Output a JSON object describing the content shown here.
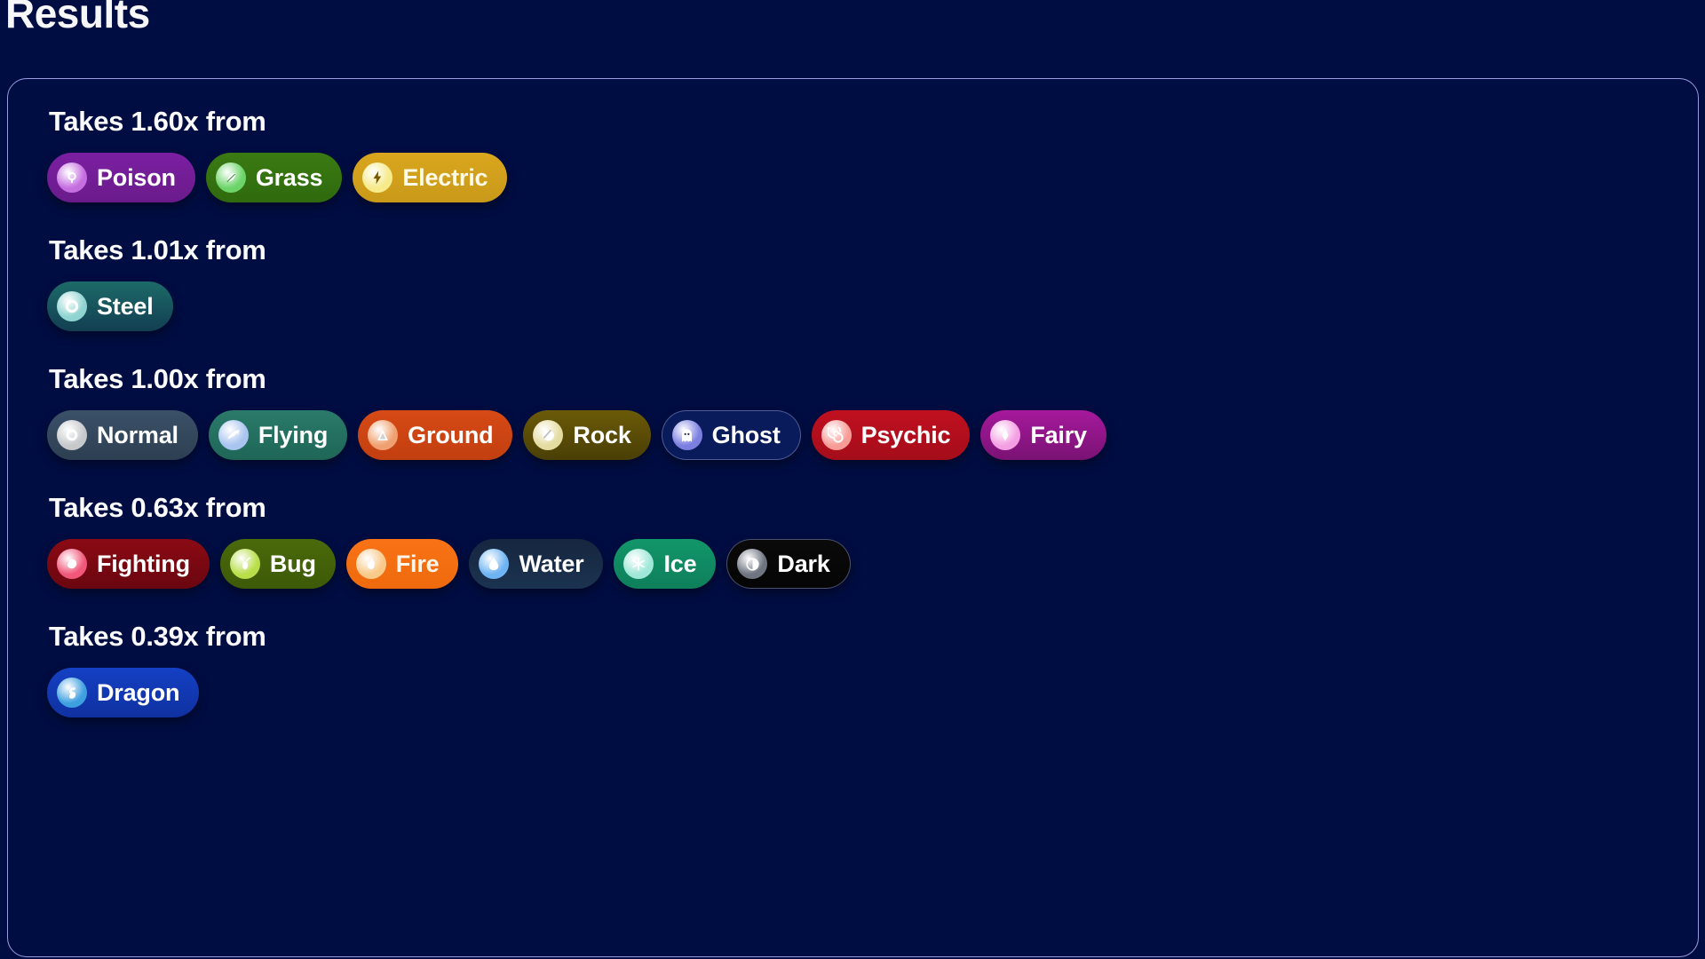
{
  "page": {
    "title": "Results",
    "background_color": "#000d42",
    "card_border_color": "#9a9ce0"
  },
  "groups": [
    {
      "heading": "Takes 1.60x from",
      "multiplier": "1.60x",
      "types": [
        {
          "label": "Poison",
          "icon": "poison-icon",
          "pill_color": "#7b1fa2",
          "pill_color2": "#6a1b8a",
          "icon_bg": "#c56ee0",
          "icon_fg": "#ffffff",
          "text_color": "#ffffff",
          "ringed": false
        },
        {
          "label": "Grass",
          "icon": "grass-icon",
          "pill_color": "#3a7a12",
          "pill_color2": "#2f6a0e",
          "icon_bg": "#6dd46a",
          "icon_fg": "#ffffff",
          "text_color": "#ffffff",
          "ringed": false
        },
        {
          "label": "Electric",
          "icon": "electric-icon",
          "pill_color": "#d9a61d",
          "pill_color2": "#c9991a",
          "icon_bg": "#f6ea8a",
          "icon_fg": "#7a5a00",
          "text_color": "#fffbe8",
          "ringed": false
        }
      ]
    },
    {
      "heading": "Takes 1.01x from",
      "multiplier": "1.01x",
      "types": [
        {
          "label": "Steel",
          "icon": "steel-icon",
          "pill_color": "#1d6a68",
          "pill_color2": "#123f52",
          "icon_bg": "#8fd4d0",
          "icon_fg": "#ffffff",
          "text_color": "#ffffff",
          "ringed": false
        }
      ]
    },
    {
      "heading": "Takes 1.00x from",
      "multiplier": "1.00x",
      "types": [
        {
          "label": "Normal",
          "icon": "normal-icon",
          "pill_color": "#3b5168",
          "pill_color2": "#2d3f52",
          "icon_bg": "#c6c8ca",
          "icon_fg": "#ffffff",
          "text_color": "#ffffff",
          "ringed": false
        },
        {
          "label": "Flying",
          "icon": "flying-icon",
          "pill_color": "#2a7a6a",
          "pill_color2": "#1f6657",
          "icon_bg": "#a8c4ef",
          "icon_fg": "#ffffff",
          "text_color": "#ffffff",
          "ringed": false
        },
        {
          "label": "Ground",
          "icon": "ground-icon",
          "pill_color": "#d64a16",
          "pill_color2": "#c23f10",
          "icon_bg": "#f0a070",
          "icon_fg": "#ffffff",
          "text_color": "#ffffff",
          "ringed": false
        },
        {
          "label": "Rock",
          "icon": "rock-icon",
          "pill_color": "#6b5a08",
          "pill_color2": "#4a3f05",
          "icon_bg": "#e4dba0",
          "icon_fg": "#ffffff",
          "text_color": "#ffffff",
          "ringed": false
        },
        {
          "label": "Ghost",
          "icon": "ghost-icon",
          "pill_color": "#0a1b5c",
          "pill_color2": "#0a1b5c",
          "icon_bg": "#7b7fe0",
          "icon_fg": "#ffffff",
          "text_color": "#ffffff",
          "ringed": true
        },
        {
          "label": "Psychic",
          "icon": "psychic-icon",
          "pill_color": "#c01020",
          "pill_color2": "#a50d1a",
          "icon_bg": "#f79b96",
          "icon_fg": "#ffffff",
          "text_color": "#ffffff",
          "ringed": false
        },
        {
          "label": "Fairy",
          "icon": "fairy-icon",
          "pill_color": "#a6199c",
          "pill_color2": "#7a1274",
          "icon_bg": "#f49fe4",
          "icon_fg": "#ffffff",
          "text_color": "#ffffff",
          "ringed": false
        }
      ]
    },
    {
      "heading": "Takes 0.63x from",
      "multiplier": "0.63x",
      "types": [
        {
          "label": "Fighting",
          "icon": "fighting-icon",
          "pill_color": "#8b0a14",
          "pill_color2": "#6a0610",
          "icon_bg": "#f0577a",
          "icon_fg": "#ffffff",
          "text_color": "#ffffff",
          "ringed": false
        },
        {
          "label": "Bug",
          "icon": "bug-icon",
          "pill_color": "#4a6a0a",
          "pill_color2": "#3d5a08",
          "icon_bg": "#b8de4a",
          "icon_fg": "#ffffff",
          "text_color": "#ffffff",
          "ringed": false
        },
        {
          "label": "Fire",
          "icon": "fire-icon",
          "pill_color": "#f97316",
          "pill_color2": "#ee6a0c",
          "icon_bg": "#f9c98a",
          "icon_fg": "#ffffff",
          "text_color": "#fff4e8",
          "ringed": false
        },
        {
          "label": "Water",
          "icon": "water-icon",
          "pill_color": "#16263f",
          "pill_color2": "#1b3350",
          "icon_bg": "#6fb4f2",
          "icon_fg": "#ffffff",
          "text_color": "#ffffff",
          "ringed": false
        },
        {
          "label": "Ice",
          "icon": "ice-icon",
          "pill_color": "#12966a",
          "pill_color2": "#0e7f5a",
          "icon_bg": "#9fe8d8",
          "icon_fg": "#ffffff",
          "text_color": "#ffffff",
          "ringed": false
        },
        {
          "label": "Dark",
          "icon": "dark-icon",
          "pill_color": "#0a0a0a",
          "pill_color2": "#050505",
          "icon_bg": "#6e7480",
          "icon_fg": "#ffffff",
          "text_color": "#ffffff",
          "ringed": true
        }
      ]
    },
    {
      "heading": "Takes 0.39x from",
      "multiplier": "0.39x",
      "types": [
        {
          "label": "Dragon",
          "icon": "dragon-icon",
          "pill_color": "#1540c4",
          "pill_color2": "#0f31a0",
          "icon_bg": "#3fa0e0",
          "icon_fg": "#ffffff",
          "text_color": "#ffffff",
          "ringed": false
        }
      ]
    }
  ]
}
